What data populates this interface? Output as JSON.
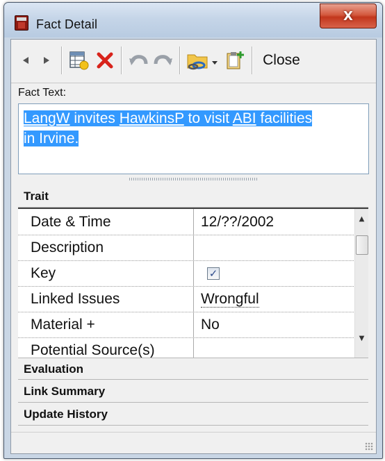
{
  "window": {
    "title": "Fact Detail",
    "close_glyph": "X"
  },
  "toolbar": {
    "back_icon": "triangle-left",
    "forward_icon": "triangle-right",
    "new_icon": "table-add",
    "delete_icon": "red-x",
    "undo_icon": "undo-arrow",
    "redo_icon": "redo-arrow",
    "link_icon": "folder-link",
    "clipboard_icon": "clipboard-add",
    "close_label": "Close"
  },
  "fact": {
    "label": "Fact Text:",
    "text_parts": [
      {
        "t": "LangW",
        "link": true
      },
      {
        "t": " invites ",
        "link": false
      },
      {
        "t": "HawkinsP",
        "link": true
      },
      {
        "t": " to visit ",
        "link": false
      },
      {
        "t": "ABI",
        "link": true
      },
      {
        "t": " facilities in Irvine.",
        "link": false
      }
    ]
  },
  "sections": {
    "trait": "Trait",
    "evaluation": "Evaluation",
    "link_summary": "Link Summary",
    "update_history": "Update History"
  },
  "traits": [
    {
      "name": "Date & Time",
      "value": "12/??/2002"
    },
    {
      "name": "Description",
      "value": ""
    },
    {
      "name": "Key",
      "value": "",
      "checkbox": true,
      "checked": true
    },
    {
      "name": "Linked Issues",
      "value": "Wrongful"
    },
    {
      "name": "Material +",
      "value": "No"
    },
    {
      "name": "Potential Source(s)",
      "value": ""
    }
  ],
  "colors": {
    "selection": "#3399ff",
    "delete_red": "#d8231b",
    "close_button": "#c2371d"
  }
}
